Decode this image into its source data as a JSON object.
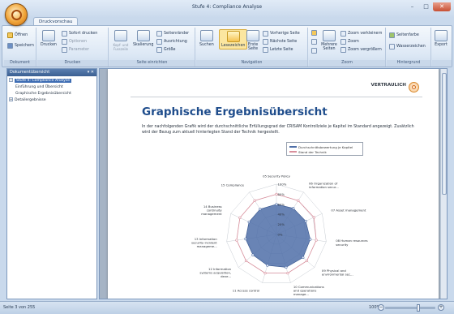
{
  "window": {
    "title": "Stufe 4: Compliance Analyse",
    "controls": [
      "–",
      "□",
      "✕"
    ]
  },
  "tabs": [
    {
      "label": "Druckvorschau",
      "active": true
    }
  ],
  "ribbon": {
    "groups": [
      {
        "name": "Dokument",
        "items": [
          "Öffnen",
          "Speichern"
        ]
      },
      {
        "name": "Drucken",
        "items": [
          "Drucken",
          "Sofort drucken",
          "Optionen",
          "Parameter"
        ]
      },
      {
        "name": "Seite einrichten",
        "items": [
          "Kopf- und Fusszeile",
          "Skalierung",
          "Seitenränder",
          "Ausrichtung",
          "Größe"
        ]
      },
      {
        "name": "Navigation",
        "items": [
          "Suchen",
          "Lesezeichen",
          "Erste Seite",
          "Vorherige Seite",
          "Nächste Seite",
          "Letzte Seite"
        ]
      },
      {
        "name": "Zoom",
        "items": [
          "Mehrere Seiten",
          "Zoom verkleinern",
          "Zoom",
          "Zoom vergrößern"
        ]
      },
      {
        "name": "Hintergrund",
        "items": [
          "Seitenfarbe",
          "Wasserzeichen"
        ]
      },
      {
        "name": "",
        "items": [
          "Export"
        ]
      }
    ],
    "selected": "Lesezeichen"
  },
  "outline": {
    "title": "Dokumentübersicht",
    "items": [
      {
        "label": "Stufe 4: Compliance Analyse",
        "level": 0,
        "selected": true,
        "toggle": "−"
      },
      {
        "label": "Einführung und Übersicht",
        "level": 1
      },
      {
        "label": "Graphische Ergebnisübersicht",
        "level": 1
      },
      {
        "label": "Detailergebnisse",
        "level": 0,
        "toggle": "+"
      }
    ]
  },
  "document": {
    "confidential": "VERTRAULICH",
    "heading": "Graphische Ergebnisübersicht",
    "intro": "In der nachfolgenden Grafik wird der durchschnittliche Erfüllungsgrad der CRISAM Kontrollziele je Kapitel im Standard angezeigt. Zusätzlich wird der Bezug zum aktuell hinterlegten Stand der Technik hergestellt."
  },
  "chart_data": {
    "type": "radar",
    "categories": [
      "05 Security Policy",
      "06 Organization of information secur...",
      "07 Asset management",
      "08 Human resources security",
      "09 Physical and environmental sec...",
      "10 Communications and operations manage...",
      "11 Access control",
      "12 Information systems acquisition, deve...",
      "13 Information security incident manageme...",
      "14 Business continuity management",
      "15 Compliance"
    ],
    "rmax": 100,
    "ticks": [
      "0%",
      "20%",
      "40%",
      "60%",
      "80%",
      "100%"
    ],
    "grid": true,
    "legend_position": "top",
    "series": [
      {
        "name": "Durchschnittsbewertung je Kapitel",
        "color": "#4f6fa8",
        "values": [
          60,
          62,
          64,
          68,
          70,
          68,
          64,
          62,
          62,
          60,
          60
        ]
      },
      {
        "name": "Stand der Technik",
        "color": "#d98f9c",
        "values": [
          80,
          80,
          82,
          80,
          80,
          80,
          80,
          80,
          80,
          80,
          80
        ]
      }
    ]
  },
  "status": {
    "page": "Seite 3 von 255",
    "zoom": "100%"
  }
}
